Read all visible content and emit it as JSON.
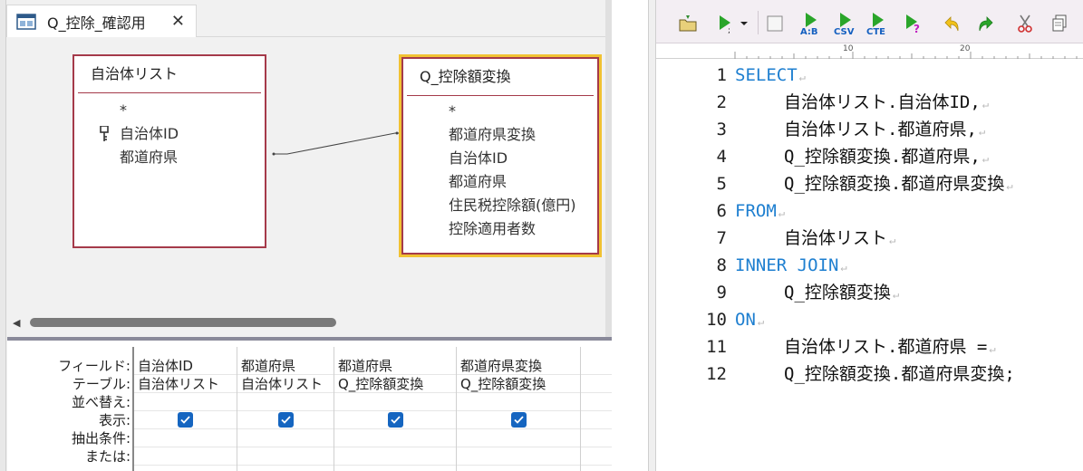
{
  "access": {
    "tab_title": "Q_控除_確認用",
    "tab_close": "✕",
    "table1": {
      "title": "自治体リスト",
      "fields": [
        "*",
        "自治体ID",
        "都道府県"
      ]
    },
    "table2": {
      "title": "Q_控除額変換",
      "fields": [
        "*",
        "都道府県変換",
        "自治体ID",
        "都道府県",
        "住民税控除額(億円)",
        "控除適用者数"
      ]
    },
    "hscroll_left": "◀",
    "grid_labels": [
      "フィールド:",
      "テーブル:",
      "並べ替え:",
      "表示:",
      "抽出条件:",
      "または:"
    ],
    "columns": [
      {
        "field": "自治体ID",
        "table": "自治体リスト"
      },
      {
        "field": "都道府県",
        "table": "自治体リスト"
      },
      {
        "field": "都道府県",
        "table": "Q_控除額変換"
      },
      {
        "field": "都道府県変換",
        "table": "Q_控除額変換"
      }
    ]
  },
  "editor": {
    "toolbar_icons": [
      "open-folder-icon",
      "run-icon",
      "dropdown-arrow-icon",
      "stop-icon",
      "export-ab-icon",
      "export-csv-icon",
      "export-cte-icon",
      "explain-icon",
      "undo-icon",
      "redo-icon",
      "cut-icon",
      "copy-icon"
    ],
    "toolbar_labels": {
      "ab": "A:B",
      "csv": "CSV",
      "cte": "CTE",
      "semicolon": ";",
      "question": "?"
    },
    "ruler": {
      "mark10": "10",
      "mark20": "20"
    },
    "eol_mark": "↵",
    "lines": [
      {
        "num": "1",
        "text": "SELECT",
        "kw": true
      },
      {
        "num": "2",
        "text": "自治体リスト.自治体ID,",
        "kw": false
      },
      {
        "num": "3",
        "text": "自治体リスト.都道府県,",
        "kw": false
      },
      {
        "num": "4",
        "text": "Q_控除額変換.都道府県,",
        "kw": false
      },
      {
        "num": "5",
        "text": "Q_控除額変換.都道府県変換",
        "kw": false
      },
      {
        "num": "6",
        "text": "FROM",
        "kw": true
      },
      {
        "num": "7",
        "text": "自治体リスト",
        "kw": false
      },
      {
        "num": "8",
        "text": "INNER JOIN",
        "kw": true
      },
      {
        "num": "9",
        "text": "Q_控除額変換",
        "kw": false
      },
      {
        "num": "10",
        "text": "ON",
        "kw": true
      },
      {
        "num": "11",
        "text": "自治体リスト.都道府県 =",
        "kw": false
      },
      {
        "num": "12",
        "text": "Q_控除額変換.都道府県変換;",
        "kw": false,
        "no_eol": true
      }
    ]
  }
}
